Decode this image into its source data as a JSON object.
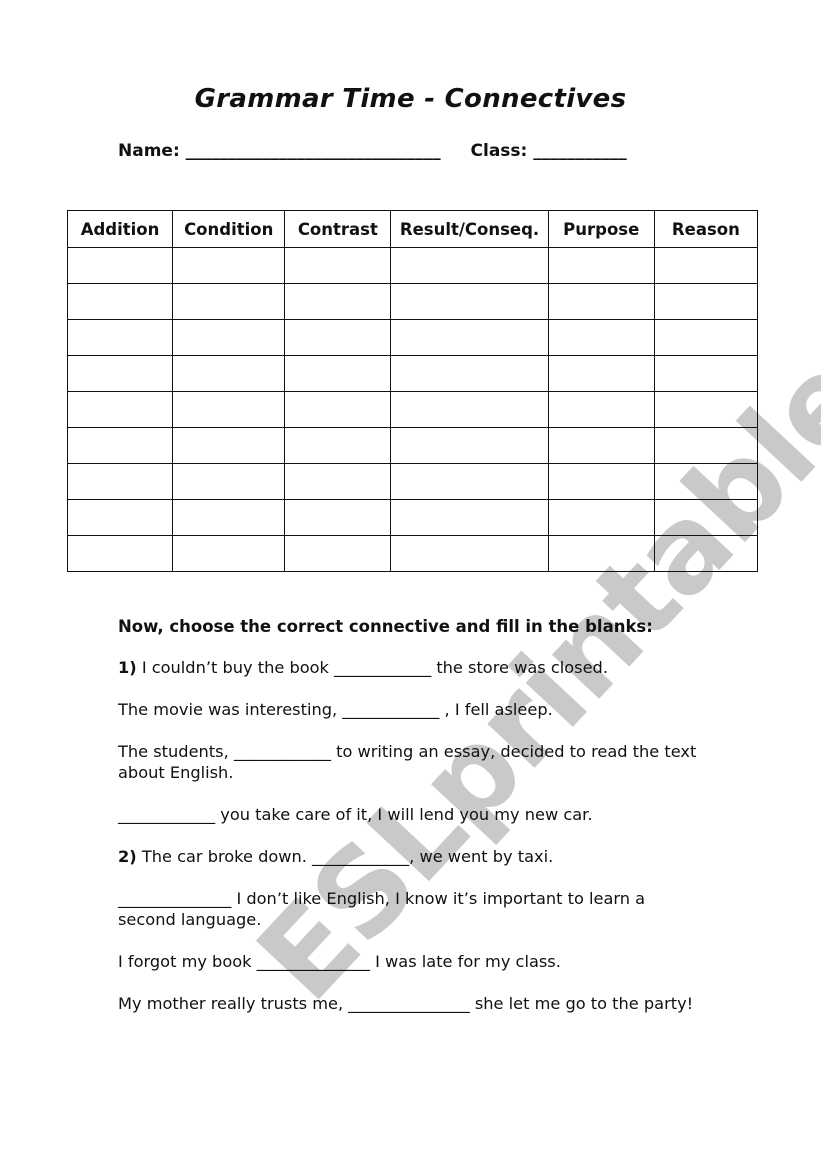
{
  "worksheet": {
    "title": "Grammar Time - Connectives",
    "name_label": "Name:",
    "name_blank": "______________________________",
    "class_label": "Class:",
    "class_blank": "___________"
  },
  "table": {
    "columns": [
      "Addition",
      "Condition",
      "Contrast",
      "Result/Conseq.",
      "Purpose",
      "Reason"
    ],
    "rows": [
      [
        "",
        "",
        "",
        "",
        "",
        ""
      ],
      [
        "",
        "",
        "",
        "",
        "",
        ""
      ],
      [
        "",
        "",
        "",
        "",
        "",
        ""
      ],
      [
        "",
        "",
        "",
        "",
        "",
        ""
      ],
      [
        "",
        "",
        "",
        "",
        "",
        ""
      ],
      [
        "",
        "",
        "",
        "",
        "",
        ""
      ],
      [
        "",
        "",
        "",
        "",
        "",
        ""
      ],
      [
        "",
        "",
        "",
        "",
        "",
        ""
      ],
      [
        "",
        "",
        "",
        "",
        "",
        ""
      ]
    ]
  },
  "exercise": {
    "instructions": "Now, choose the correct connective and fill in the blanks:",
    "sentences": [
      {
        "number": "1)",
        "text": " I couldn’t buy the book ____________ the store was closed."
      },
      {
        "number": "",
        "text": "The movie was interesting, ____________ , I fell asleep."
      },
      {
        "number": "",
        "text": "The students, ____________ to writing an essay, decided to read the text about English."
      },
      {
        "number": "",
        "text": "____________ you take care of it, I will lend you my new car."
      },
      {
        "number": "2)",
        "text": " The car broke down. ____________, we went by taxi."
      },
      {
        "number": "",
        "text": "______________ I don’t like English, I know it’s important to learn a second language."
      },
      {
        "number": "",
        "text": "I forgot my book ______________ I was late for my class."
      },
      {
        "number": "",
        "text": "My mother really trusts me, _______________ she let me go to the party!"
      }
    ]
  },
  "watermark": {
    "text": "ESLprintables.com",
    "color": "#c9c9c9"
  }
}
